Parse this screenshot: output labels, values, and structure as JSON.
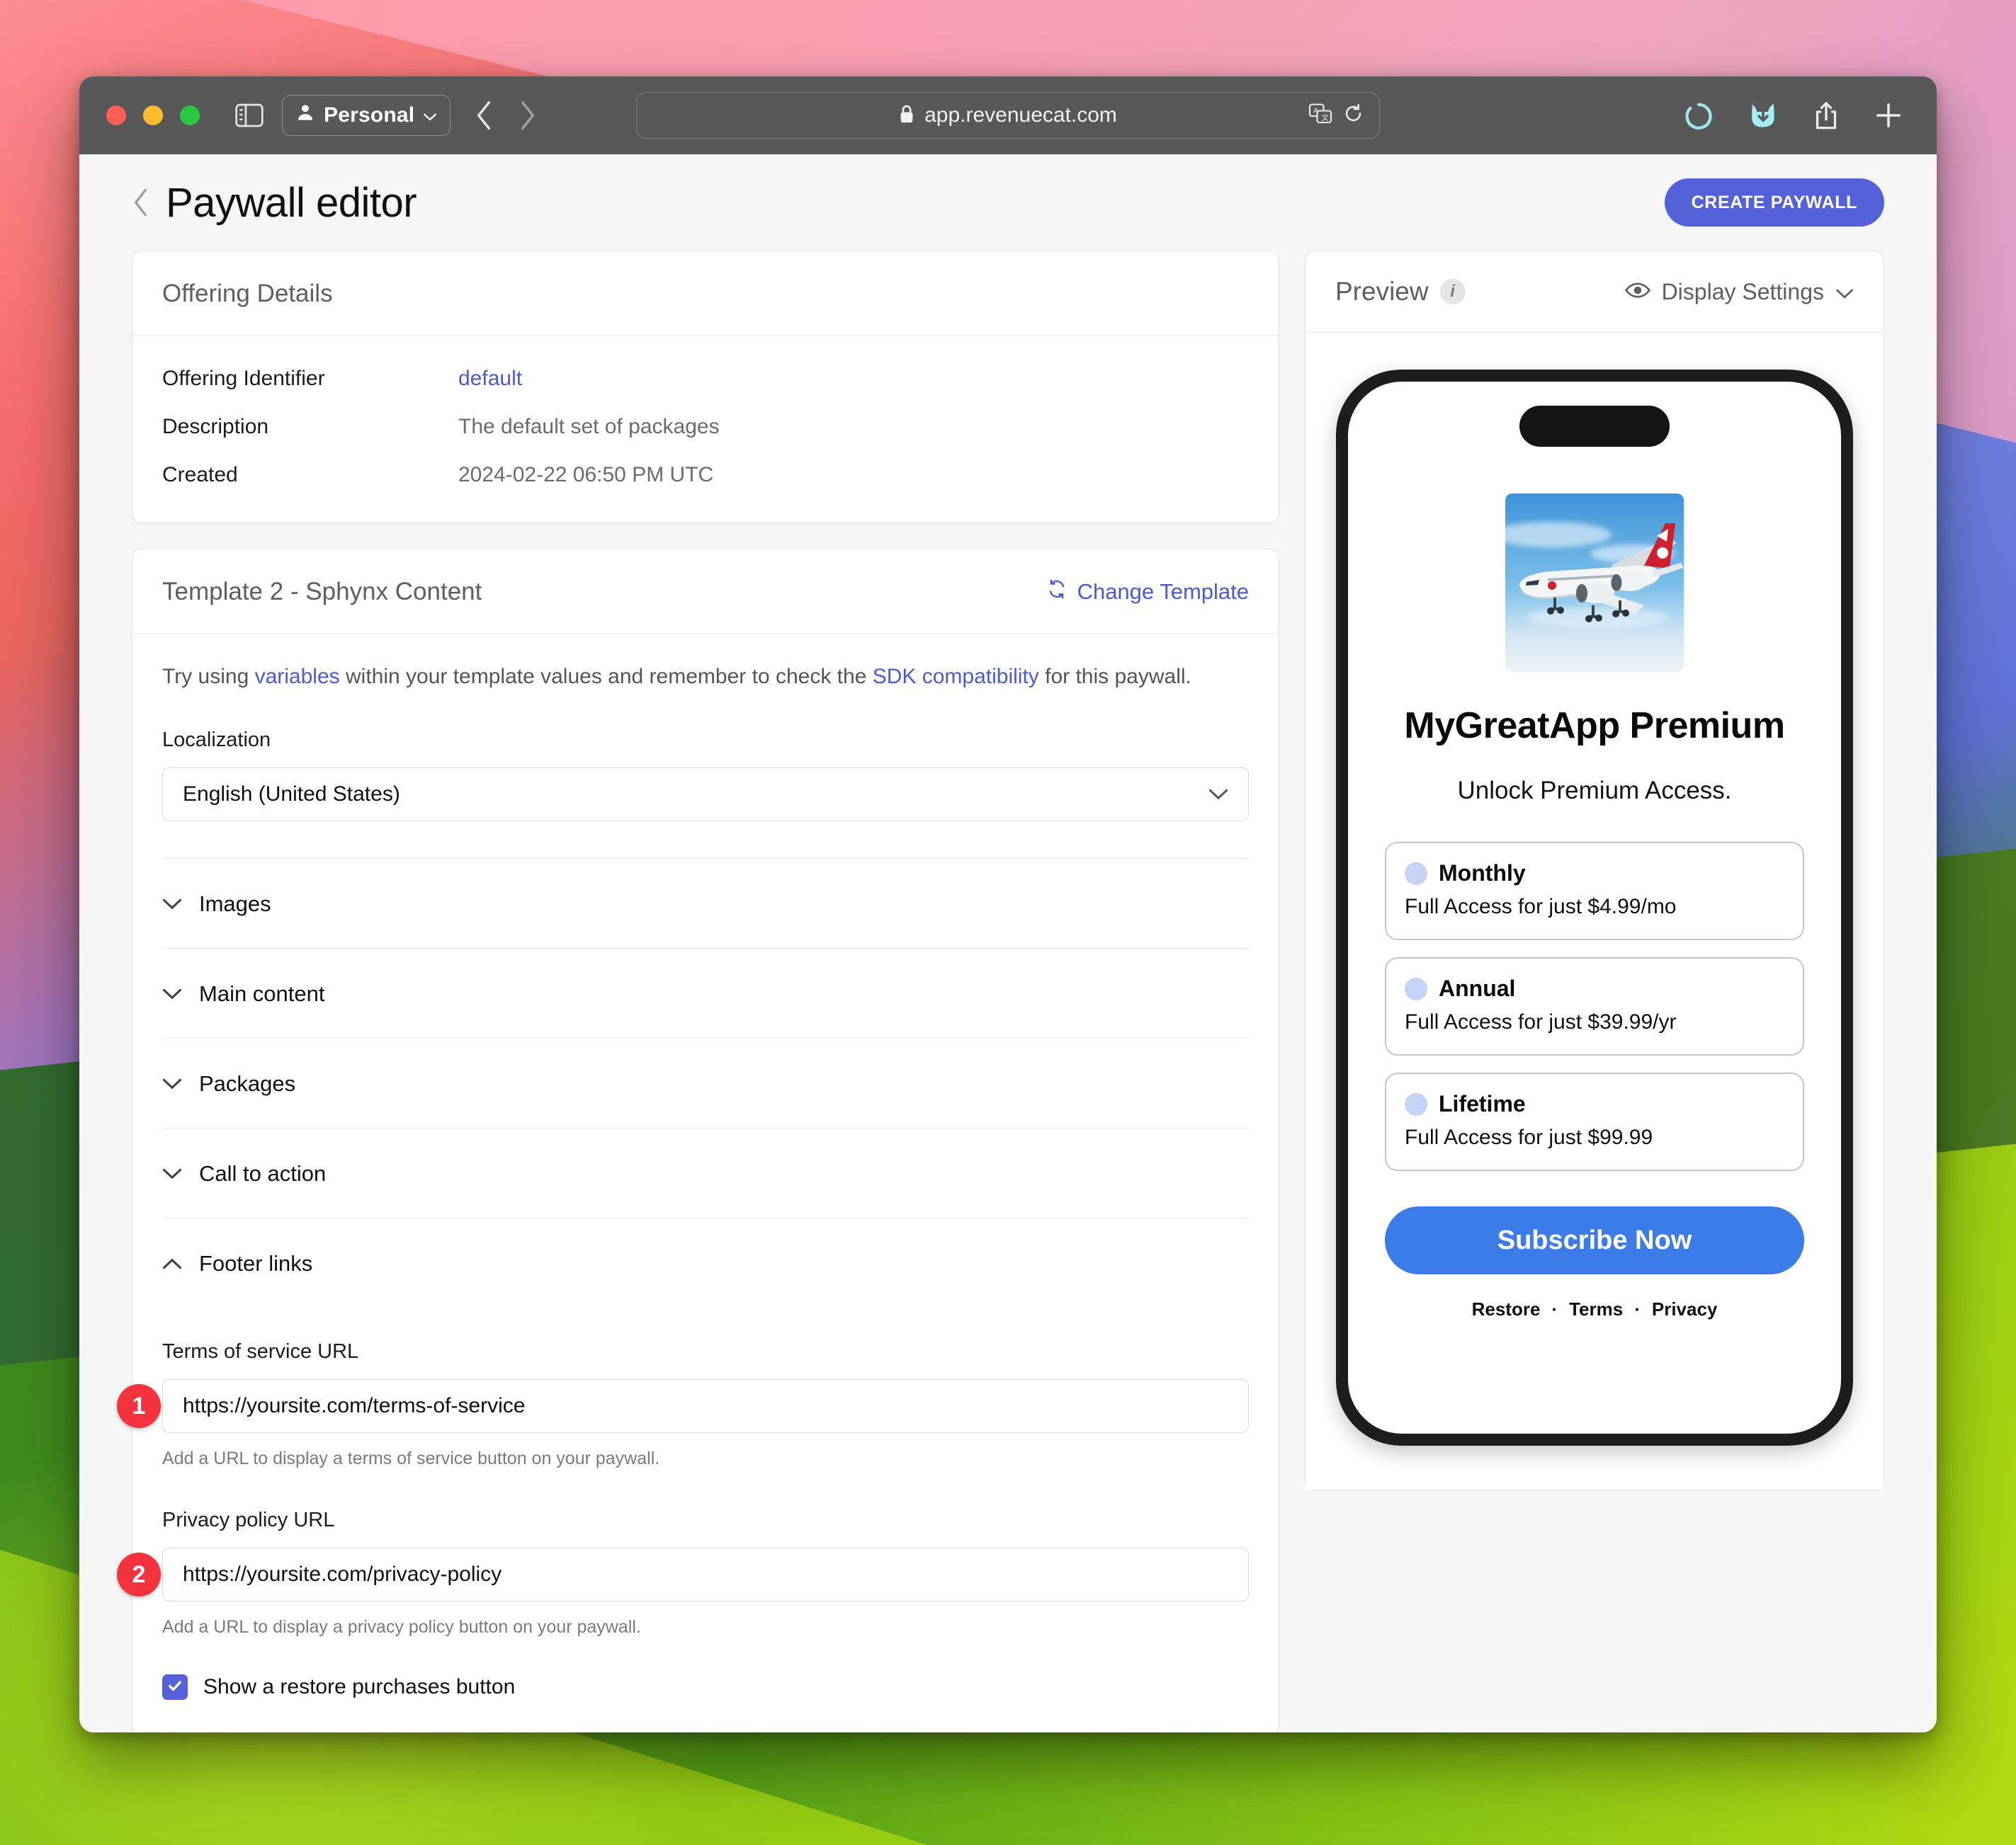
{
  "browser": {
    "profile_label": "Personal",
    "url": "app.revenuecat.com",
    "icons": {
      "sidebar": "sidebar-icon",
      "person": "person-icon",
      "back": "chevron-left-icon",
      "forward": "chevron-right-icon",
      "lock": "lock-icon",
      "translate": "translate-icon",
      "reload": "reload-icon",
      "spinner": "loading-spinner-icon",
      "download": "download-icon",
      "share": "share-icon",
      "new_tab": "plus-icon"
    }
  },
  "header": {
    "back_icon": "chevron-left-icon",
    "title": "Paywall editor",
    "create_button": "CREATE PAYWALL"
  },
  "offering_details": {
    "card_title": "Offering Details",
    "rows": [
      {
        "label": "Offering Identifier",
        "value": "default",
        "is_link": true
      },
      {
        "label": "Description",
        "value": "The default set of packages",
        "is_link": false
      },
      {
        "label": "Created",
        "value": "2024-02-22 06:50 PM UTC",
        "is_link": false
      }
    ]
  },
  "template": {
    "card_title": "Template 2 - Sphynx Content",
    "change_template": "Change Template",
    "change_template_icon": "refresh-icon",
    "hint": {
      "part1": "Try using ",
      "link1": "variables",
      "part2": " within your template values and remember to check the ",
      "link2": "SDK compatibility",
      "part3": " for this paywall."
    },
    "localization": {
      "label": "Localization",
      "value": "English (United States)",
      "chevron_icon": "chevron-down-icon"
    },
    "sections": [
      {
        "label": "Images",
        "expanded": false,
        "icon": "chevron-down-icon"
      },
      {
        "label": "Main content",
        "expanded": false,
        "icon": "chevron-down-icon"
      },
      {
        "label": "Packages",
        "expanded": false,
        "icon": "chevron-down-icon"
      },
      {
        "label": "Call to action",
        "expanded": false,
        "icon": "chevron-down-icon"
      },
      {
        "label": "Footer links",
        "expanded": true,
        "icon": "chevron-up-icon"
      }
    ],
    "footer_links": {
      "terms": {
        "badge": "1",
        "label": "Terms of service URL",
        "value": "https://yoursite.com/terms-of-service",
        "helper": "Add a URL to display a terms of service button on your paywall."
      },
      "privacy": {
        "badge": "2",
        "label": "Privacy policy URL",
        "value": "https://yoursite.com/privacy-policy",
        "helper": "Add a URL to display a privacy policy button on your paywall."
      },
      "restore": {
        "label": "Show a restore purchases button",
        "checked": true,
        "check_icon": "check-icon"
      }
    }
  },
  "preview": {
    "title": "Preview",
    "info_icon": "info-icon",
    "display_settings": "Display Settings",
    "eye_icon": "eye-icon",
    "chevron_icon": "chevron-down-icon",
    "phone": {
      "hero_image": "airplane-photo",
      "title": "MyGreatApp Premium",
      "subtitle": "Unlock Premium Access.",
      "packages": [
        {
          "title": "Monthly",
          "subtitle": "Full Access for just $4.99/mo"
        },
        {
          "title": "Annual",
          "subtitle": "Full Access for just $39.99/yr"
        },
        {
          "title": "Lifetime",
          "subtitle": "Full Access for just $99.99"
        }
      ],
      "cta": "Subscribe Now",
      "footer_links": [
        "Restore",
        "Terms",
        "Privacy"
      ],
      "footer_separator": "·"
    }
  },
  "colors": {
    "brand_indigo": "#5561d8",
    "cta_blue": "#3b7ce8",
    "link_blue": "#4a5bd4",
    "badge_red": "#f5333f"
  }
}
